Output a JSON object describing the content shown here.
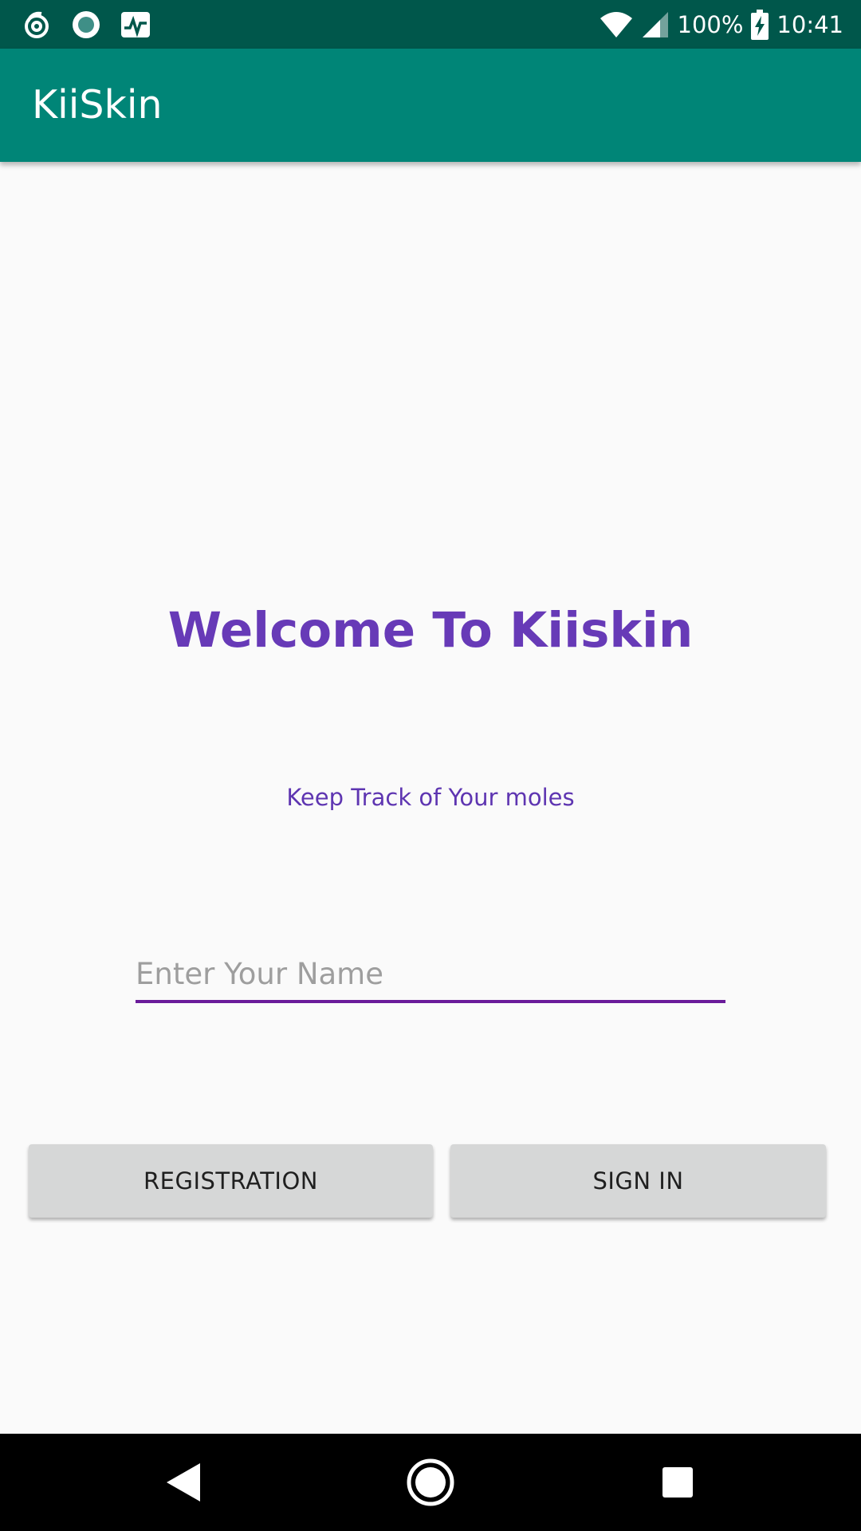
{
  "status_bar": {
    "battery": "100%",
    "time": "10:41",
    "icons": [
      "swirl-notification-icon",
      "circle-notification-icon",
      "activity-notification-icon",
      "wifi-icon",
      "signal-icon",
      "battery-charging-icon"
    ]
  },
  "app_bar": {
    "title": "KiiSkin"
  },
  "main": {
    "welcome": "Welcome To Kiiskin",
    "subtitle": "Keep Track of Your moles",
    "name_input": {
      "placeholder": "Enter Your Name",
      "value": ""
    },
    "registration_label": "REGISTRATION",
    "sign_in_label": "SIGN IN"
  },
  "nav_bar": {
    "icons": [
      "back-icon",
      "home-icon",
      "recents-icon"
    ]
  },
  "colors": {
    "status_bar": "#00574b",
    "app_bar": "#008577",
    "accent_purple": "#673ab7",
    "underline": "#6a1b9a",
    "button_bg": "#d6d7d7"
  }
}
